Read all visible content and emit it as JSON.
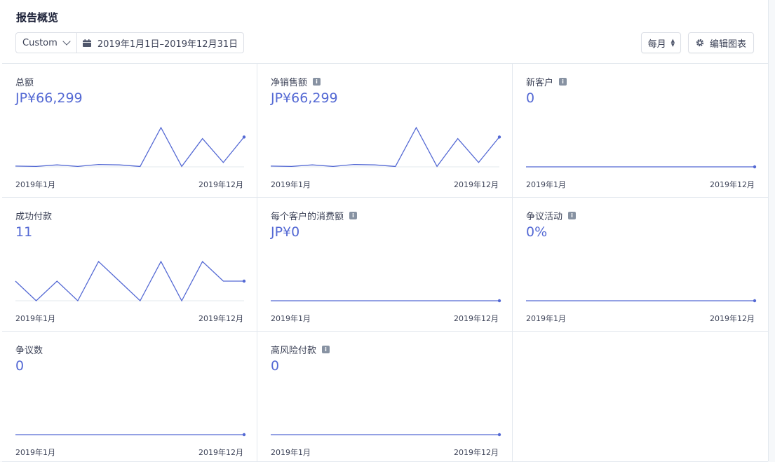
{
  "page": {
    "title": "报告概览"
  },
  "toolbar": {
    "range_preset": "Custom",
    "date_range": "2019年1月1日–2019年12月31日",
    "interval": "每月",
    "edit_label": "编辑图表"
  },
  "colors": {
    "accent": "#5469d4",
    "baseline": "#e3e8ee"
  },
  "cards": [
    {
      "label": "总额",
      "value": "JP¥66,299",
      "info": false,
      "axis_start": "2019年1月",
      "axis_end": "2019年12月"
    },
    {
      "label": "净销售额",
      "value": "JP¥66,299",
      "info": true,
      "axis_start": "2019年1月",
      "axis_end": "2019年12月"
    },
    {
      "label": "新客户",
      "value": "0",
      "info": true,
      "axis_start": "2019年1月",
      "axis_end": "2019年12月"
    },
    {
      "label": "成功付款",
      "value": "11",
      "info": false,
      "axis_start": "2019年1月",
      "axis_end": "2019年12月"
    },
    {
      "label": "每个客户的消费额",
      "value": "JP¥0",
      "info": true,
      "axis_start": "2019年1月",
      "axis_end": "2019年12月"
    },
    {
      "label": "争议活动",
      "value": "0%",
      "info": true,
      "axis_start": "2019年1月",
      "axis_end": "2019年12月"
    },
    {
      "label": "争议数",
      "value": "0",
      "info": false,
      "axis_start": "2019年1月",
      "axis_end": "2019年12月"
    },
    {
      "label": "高风险付款",
      "value": "0",
      "info": true,
      "axis_start": "2019年1月",
      "axis_end": "2019年12月"
    }
  ],
  "chart_data": [
    {
      "type": "line",
      "x": [
        "2019-01",
        "2019-02",
        "2019-03",
        "2019-04",
        "2019-05",
        "2019-06",
        "2019-07",
        "2019-08",
        "2019-09",
        "2019-10",
        "2019-11",
        "2019-12"
      ],
      "values": [
        0.02,
        0.01,
        0.05,
        0.01,
        0.06,
        0.05,
        0.01,
        1.0,
        0.01,
        0.72,
        0.11,
        0.76
      ]
    },
    {
      "type": "line",
      "x": [
        "2019-01",
        "2019-02",
        "2019-03",
        "2019-04",
        "2019-05",
        "2019-06",
        "2019-07",
        "2019-08",
        "2019-09",
        "2019-10",
        "2019-11",
        "2019-12"
      ],
      "values": [
        0.02,
        0.01,
        0.05,
        0.01,
        0.06,
        0.05,
        0.01,
        1.0,
        0.01,
        0.72,
        0.11,
        0.76
      ]
    },
    {
      "type": "line",
      "x": [
        "2019-01",
        "2019-02",
        "2019-03",
        "2019-04",
        "2019-05",
        "2019-06",
        "2019-07",
        "2019-08",
        "2019-09",
        "2019-10",
        "2019-11",
        "2019-12"
      ],
      "values": [
        0,
        0,
        0,
        0,
        0,
        0,
        0,
        0,
        0,
        0,
        0,
        0
      ]
    },
    {
      "type": "line",
      "x": [
        "2019-01",
        "2019-02",
        "2019-03",
        "2019-04",
        "2019-05",
        "2019-06",
        "2019-07",
        "2019-08",
        "2019-09",
        "2019-10",
        "2019-11",
        "2019-12"
      ],
      "values": [
        1,
        0,
        1,
        0,
        2,
        1,
        0,
        2,
        0,
        2,
        1,
        1
      ]
    },
    {
      "type": "line",
      "x": [
        "2019-01",
        "2019-02",
        "2019-03",
        "2019-04",
        "2019-05",
        "2019-06",
        "2019-07",
        "2019-08",
        "2019-09",
        "2019-10",
        "2019-11",
        "2019-12"
      ],
      "values": [
        0,
        0,
        0,
        0,
        0,
        0,
        0,
        0,
        0,
        0,
        0,
        0
      ]
    },
    {
      "type": "line",
      "x": [
        "2019-01",
        "2019-02",
        "2019-03",
        "2019-04",
        "2019-05",
        "2019-06",
        "2019-07",
        "2019-08",
        "2019-09",
        "2019-10",
        "2019-11",
        "2019-12"
      ],
      "values": [
        0,
        0,
        0,
        0,
        0,
        0,
        0,
        0,
        0,
        0,
        0,
        0
      ]
    },
    {
      "type": "line",
      "x": [
        "2019-01",
        "2019-02",
        "2019-03",
        "2019-04",
        "2019-05",
        "2019-06",
        "2019-07",
        "2019-08",
        "2019-09",
        "2019-10",
        "2019-11",
        "2019-12"
      ],
      "values": [
        0,
        0,
        0,
        0,
        0,
        0,
        0,
        0,
        0,
        0,
        0,
        0
      ]
    },
    {
      "type": "line",
      "x": [
        "2019-01",
        "2019-02",
        "2019-03",
        "2019-04",
        "2019-05",
        "2019-06",
        "2019-07",
        "2019-08",
        "2019-09",
        "2019-10",
        "2019-11",
        "2019-12"
      ],
      "values": [
        0,
        0,
        0,
        0,
        0,
        0,
        0,
        0,
        0,
        0,
        0,
        0
      ]
    }
  ]
}
